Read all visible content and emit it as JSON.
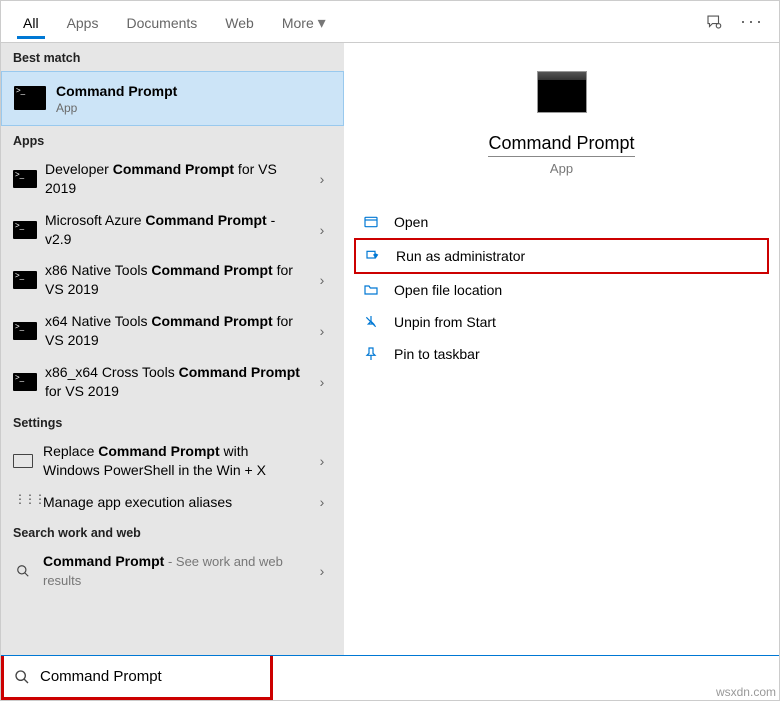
{
  "tabs": {
    "all": "All",
    "apps": "Apps",
    "documents": "Documents",
    "web": "Web",
    "more": "More"
  },
  "sections": {
    "best_match": "Best match",
    "apps": "Apps",
    "settings": "Settings",
    "search_work_web": "Search work and web"
  },
  "best_match": {
    "title": "Command Prompt",
    "sub": "App"
  },
  "apps_results": [
    {
      "pre": "Developer ",
      "bold": "Command Prompt",
      "post": " for VS 2019"
    },
    {
      "pre": "Microsoft Azure ",
      "bold": "Command Prompt",
      "post": " - v2.9"
    },
    {
      "pre": "x86 Native Tools ",
      "bold": "Command Prompt",
      "post": " for VS 2019"
    },
    {
      "pre": "x64 Native Tools ",
      "bold": "Command Prompt",
      "post": " for VS 2019"
    },
    {
      "pre": "x86_x64 Cross Tools ",
      "bold": "Command Prompt",
      "post": " for VS 2019"
    }
  ],
  "settings_results": [
    {
      "pre": "Replace ",
      "bold": "Command Prompt",
      "post": " with Windows PowerShell in the Win + X"
    },
    {
      "pre": "Manage app execution aliases",
      "bold": "",
      "post": ""
    }
  ],
  "web_result": {
    "bold": "Command Prompt",
    "post": " - See work and web results"
  },
  "preview": {
    "title": "Command Prompt",
    "sub": "App",
    "actions": {
      "open": "Open",
      "run_admin": "Run as administrator",
      "open_file_loc": "Open file location",
      "unpin_start": "Unpin from Start",
      "pin_taskbar": "Pin to taskbar"
    }
  },
  "search": {
    "value": "Command Prompt"
  },
  "watermark": "wsxdn.com"
}
